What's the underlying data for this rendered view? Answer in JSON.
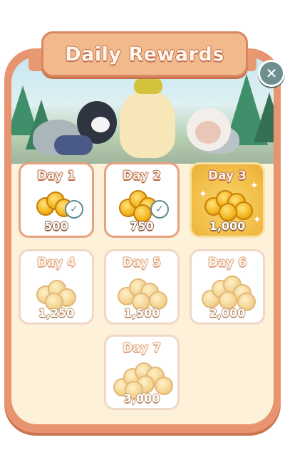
{
  "header": {
    "title": "Daily Rewards"
  },
  "close_button": {
    "icon": "close-icon",
    "symbol": "✕"
  },
  "scene": {
    "description_icon": "characters-illustration"
  },
  "rewards": [
    {
      "day": "Day 1",
      "amount": "500",
      "state": "claimed",
      "check": "✓"
    },
    {
      "day": "Day 2",
      "amount": "750",
      "state": "claimed",
      "check": "✓"
    },
    {
      "day": "Day 3",
      "amount": "1,000",
      "state": "today"
    },
    {
      "day": "Day 4",
      "amount": "1,250",
      "state": "locked"
    },
    {
      "day": "Day 5",
      "amount": "1,500",
      "state": "locked"
    },
    {
      "day": "Day 6",
      "amount": "2,000",
      "state": "locked"
    },
    {
      "day": "Day 7",
      "amount": "3,000",
      "state": "locked"
    }
  ],
  "colors": {
    "panel": "#e99470",
    "panel_inner": "#fdf1d9",
    "banner": "#f2b98c",
    "today_card": "#f1bc45",
    "close_button": "#6f8e90"
  }
}
